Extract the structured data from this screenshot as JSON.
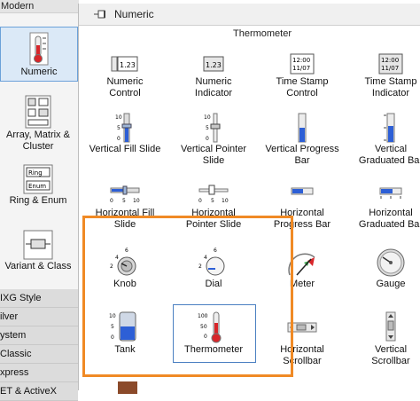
{
  "left_palette": {
    "header": "Modern",
    "categories": [
      {
        "label": "Numeric",
        "icon": "thermometer-icon",
        "selected": true
      },
      {
        "label": "Array, Matrix &",
        "label2": "Cluster",
        "icon": "array-icon"
      },
      {
        "label": "Ring & Enum",
        "icon": "ring-enum-icon"
      },
      {
        "label": "Variant & Class",
        "icon": "variant-icon"
      }
    ],
    "other_palettes": [
      "IXG Style",
      "ilver",
      "ystem",
      "Classic",
      "xpress",
      "ET & ActiveX"
    ]
  },
  "panel": {
    "title": "Numeric",
    "tooltip": "Thermometer",
    "items": [
      {
        "label": "Numeric",
        "label2": "Control",
        "display": "1.23"
      },
      {
        "label": "Numeric",
        "label2": "Indicator",
        "display": "1.23"
      },
      {
        "label": "Time Stamp",
        "label2": "Control",
        "display": "12:00",
        "display2": "11/07"
      },
      {
        "label": "Time Stamp",
        "label2": "Indicator",
        "display": "12:00",
        "display2": "11/07"
      },
      {
        "label": "Vertical Fill Slide",
        "label2": "",
        "ticks": [
          "10",
          "5",
          "0"
        ]
      },
      {
        "label": "Vertical Pointer",
        "label2": "Slide",
        "ticks": [
          "10",
          "5",
          "0"
        ]
      },
      {
        "label": "Vertical Progress",
        "label2": "Bar"
      },
      {
        "label": "Vertical",
        "label2": "Graduated Bar"
      },
      {
        "label": "Horizontal Fill",
        "label2": "Slide",
        "ticks": [
          "0",
          "5",
          "10"
        ]
      },
      {
        "label": "Horizontal",
        "label2": "Pointer Slide",
        "ticks": [
          "0",
          "5",
          "10"
        ]
      },
      {
        "label": "Horizontal",
        "label2": "Progress Bar"
      },
      {
        "label": "Horizontal",
        "label2": "Graduated Bar"
      },
      {
        "label": "Knob",
        "label2": "",
        "ticks": [
          "6",
          "4",
          "2"
        ]
      },
      {
        "label": "Dial",
        "label2": "",
        "ticks": [
          "6",
          "4",
          "2"
        ]
      },
      {
        "label": "Meter",
        "label2": ""
      },
      {
        "label": "Gauge",
        "label2": ""
      },
      {
        "label": "Tank",
        "label2": "",
        "ticks": [
          "10",
          "5",
          "0"
        ]
      },
      {
        "label": "Thermometer",
        "label2": "",
        "ticks": [
          "100",
          "50",
          "0"
        ]
      },
      {
        "label": "Horizontal",
        "label2": "Scrollbar"
      },
      {
        "label": "Vertical",
        "label2": "Scrollbar"
      }
    ]
  },
  "colors": {
    "highlight": "#f08a25",
    "selection": "#4a7fc1",
    "fill_blue": "#2d5fd6",
    "thermo_red": "#d8262a"
  }
}
